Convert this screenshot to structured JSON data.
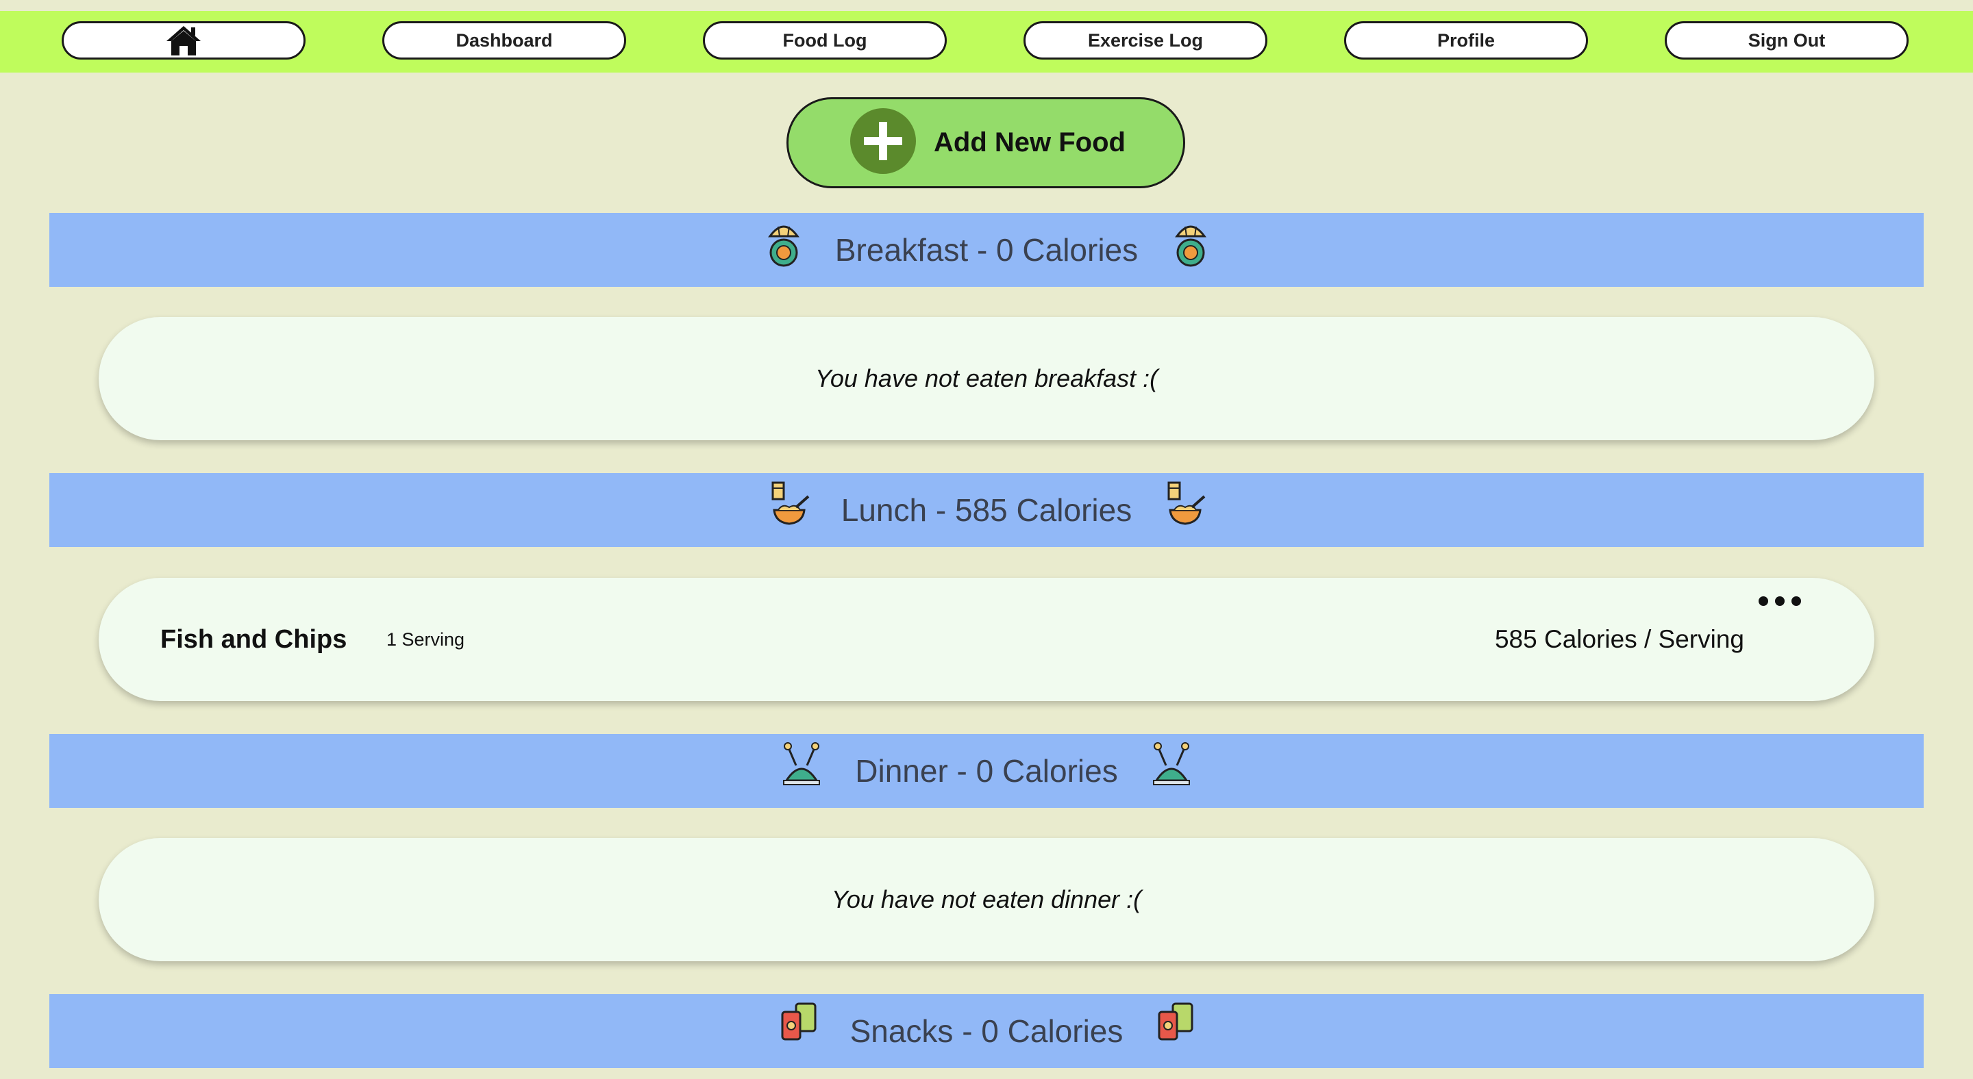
{
  "nav": {
    "home_icon": "home-icon",
    "items": [
      "Dashboard",
      "Food Log",
      "Exercise Log",
      "Profile",
      "Sign Out"
    ]
  },
  "add_food": {
    "label": "Add New Food",
    "icon": "plus-icon"
  },
  "meals": {
    "breakfast": {
      "title": "Breakfast - 0 Calories",
      "icon": "breakfast-icon",
      "empty_message": "You have not eaten breakfast :("
    },
    "lunch": {
      "title": "Lunch - 585 Calories",
      "icon": "lunch-icon",
      "entries": [
        {
          "name": "Fish and Chips",
          "servings": "1 Serving",
          "calories": "585 Calories / Serving"
        }
      ]
    },
    "dinner": {
      "title": "Dinner - 0 Calories",
      "icon": "dinner-icon",
      "empty_message": "You have not eaten dinner :("
    },
    "snacks": {
      "title": "Snacks - 0 Calories",
      "icon": "snacks-icon"
    }
  },
  "colors": {
    "background": "#e9ebce",
    "navbar": "#bffc5c",
    "meal_header": "#91b8f7",
    "card": "#f1fbef",
    "add_button": "#94dc6a",
    "add_circle": "#5b8a2c"
  }
}
